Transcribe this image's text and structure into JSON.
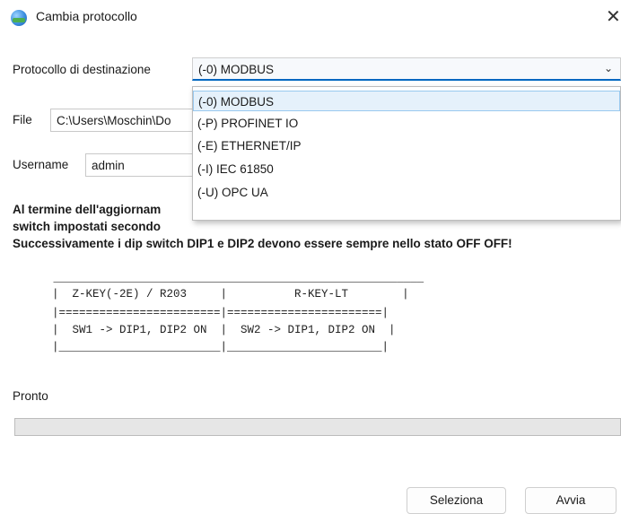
{
  "window": {
    "title": "Cambia protocollo",
    "icon": "globe-icon",
    "close": "✕"
  },
  "form": {
    "protocol_label": "Protocollo di destinazione",
    "protocol_value": "(-0) MODBUS",
    "file_label": "File",
    "file_value": "C:\\Users\\Moschin\\Do",
    "username_label": "Username",
    "username_value": "admin"
  },
  "dropdown": {
    "options": [
      "(-0) MODBUS",
      "(-P) PROFINET IO",
      "(-E) ETHERNET/IP",
      "(-I) IEC 61850",
      "(-U) OPC UA"
    ],
    "selected_index": 0
  },
  "message": {
    "line1": "Al termine dell'aggiornam",
    "line2": "switch impostati secondo",
    "line3": "Successivamente i dip switch DIP1 e DIP2 devono essere sempre nello stato OFF OFF!"
  },
  "table": {
    "top": " _______________________________________________________",
    "header": "|  Z-KEY(-2E) / R203     |          R-KEY-LT        |",
    "separator": "|========================|=======================|",
    "row": "|  SW1 -> DIP1, DIP2 ON  |  SW2 -> DIP1, DIP2 ON  |",
    "bottom": "|________________________|_______________________|"
  },
  "status": {
    "text": "Pronto",
    "progress": 0
  },
  "buttons": {
    "select": "Seleziona",
    "start": "Avvia"
  },
  "colors": {
    "accent": "#0067c0",
    "selection_bg": "#e5f1fb",
    "selection_border": "#99c9ef"
  }
}
